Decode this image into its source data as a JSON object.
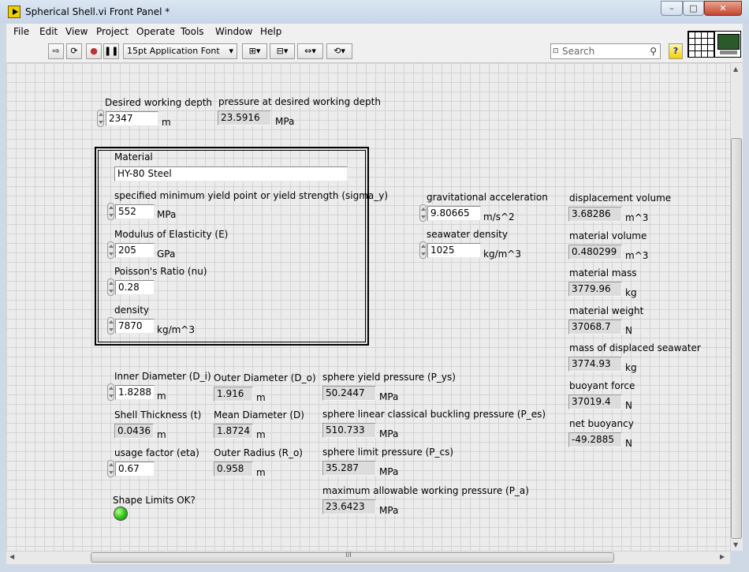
{
  "window": {
    "title": "Spherical Shell.vi Front Panel *",
    "minimize_glyph": "–",
    "maximize_glyph": "□",
    "close_glyph": "✕"
  },
  "menu": [
    "File",
    "Edit",
    "View",
    "Project",
    "Operate",
    "Tools",
    "Window",
    "Help"
  ],
  "toolbar": {
    "run_icon": "run-arrow-icon",
    "run_continuously_icon": "run-continuously-icon",
    "abort_icon": "abort-icon",
    "pause_icon": "pause-icon",
    "font": "15pt Application Font",
    "search_placeholder": "Search",
    "help_glyph": "?"
  },
  "panel": {
    "depth": {
      "label": "Desired working depth",
      "value": "2347",
      "unit": "m"
    },
    "pressure_depth": {
      "label": "pressure at desired working depth",
      "value": "23.5916",
      "unit": "MPa"
    },
    "material": {
      "label": "Material",
      "value": "HY-80 Steel",
      "sigma_y": {
        "label": "specified minimum yield point or yield strength (sigma_y)",
        "value": "552",
        "unit": "MPa"
      },
      "E": {
        "label": "Modulus of Elasticity (E)",
        "value": "205",
        "unit": "GPa"
      },
      "nu": {
        "label": "Poisson's Ratio (nu)",
        "value": "0.28"
      },
      "density": {
        "label": "density",
        "value": "7870",
        "unit": "kg/m^3"
      }
    },
    "grav": {
      "label": "gravitational acceleration",
      "value": "9.80665",
      "unit": "m/s^2"
    },
    "seawater": {
      "label": "seawater density",
      "value": "1025",
      "unit": "kg/m^3"
    },
    "disp_volume": {
      "label": "displacement volume",
      "value": "3.68286",
      "unit": "m^3"
    },
    "mat_volume": {
      "label": "material volume",
      "value": "0.480299",
      "unit": "m^3"
    },
    "mat_mass": {
      "label": "material mass",
      "value": "3779.96",
      "unit": "kg"
    },
    "mat_weight": {
      "label": "material weight",
      "value": "37068.7",
      "unit": "N"
    },
    "mass_seawater": {
      "label": "mass of displaced seawater",
      "value": "3774.93",
      "unit": "kg"
    },
    "buoyant": {
      "label": "buoyant force",
      "value": "37019.4",
      "unit": "N"
    },
    "net_buoy": {
      "label": "net buoyancy",
      "value": "-49.2885",
      "unit": "N"
    },
    "inner_d": {
      "label": "Inner Diameter (D_i)",
      "value": "1.8288",
      "unit": "m"
    },
    "outer_d": {
      "label": "Outer Diameter (D_o)",
      "value": "1.916",
      "unit": "m"
    },
    "thickness": {
      "label": "Shell Thickness (t)",
      "value": "0.0436",
      "unit": "m"
    },
    "mean_d": {
      "label": "Mean Diameter (D)",
      "value": "1.8724",
      "unit": "m"
    },
    "eta": {
      "label": "usage factor (eta)",
      "value": "0.67"
    },
    "outer_r": {
      "label": "Outer Radius (R_o)",
      "value": "0.958",
      "unit": "m"
    },
    "p_ys": {
      "label": "sphere yield pressure (P_ys)",
      "value": "50.2447",
      "unit": "MPa"
    },
    "p_es": {
      "label": "sphere linear classical buckling pressure (P_es)",
      "value": "510.733",
      "unit": "MPa"
    },
    "p_cs": {
      "label": "sphere limit pressure (P_cs)",
      "value": "35.287",
      "unit": "MPa"
    },
    "p_a": {
      "label": "maximum allowable working pressure (P_a)",
      "value": "23.6423",
      "unit": "MPa"
    },
    "shape_ok": {
      "label": "Shape Limits OK?",
      "led_color": "#2cc21a"
    }
  },
  "scrollbar": {
    "grip": "III"
  }
}
